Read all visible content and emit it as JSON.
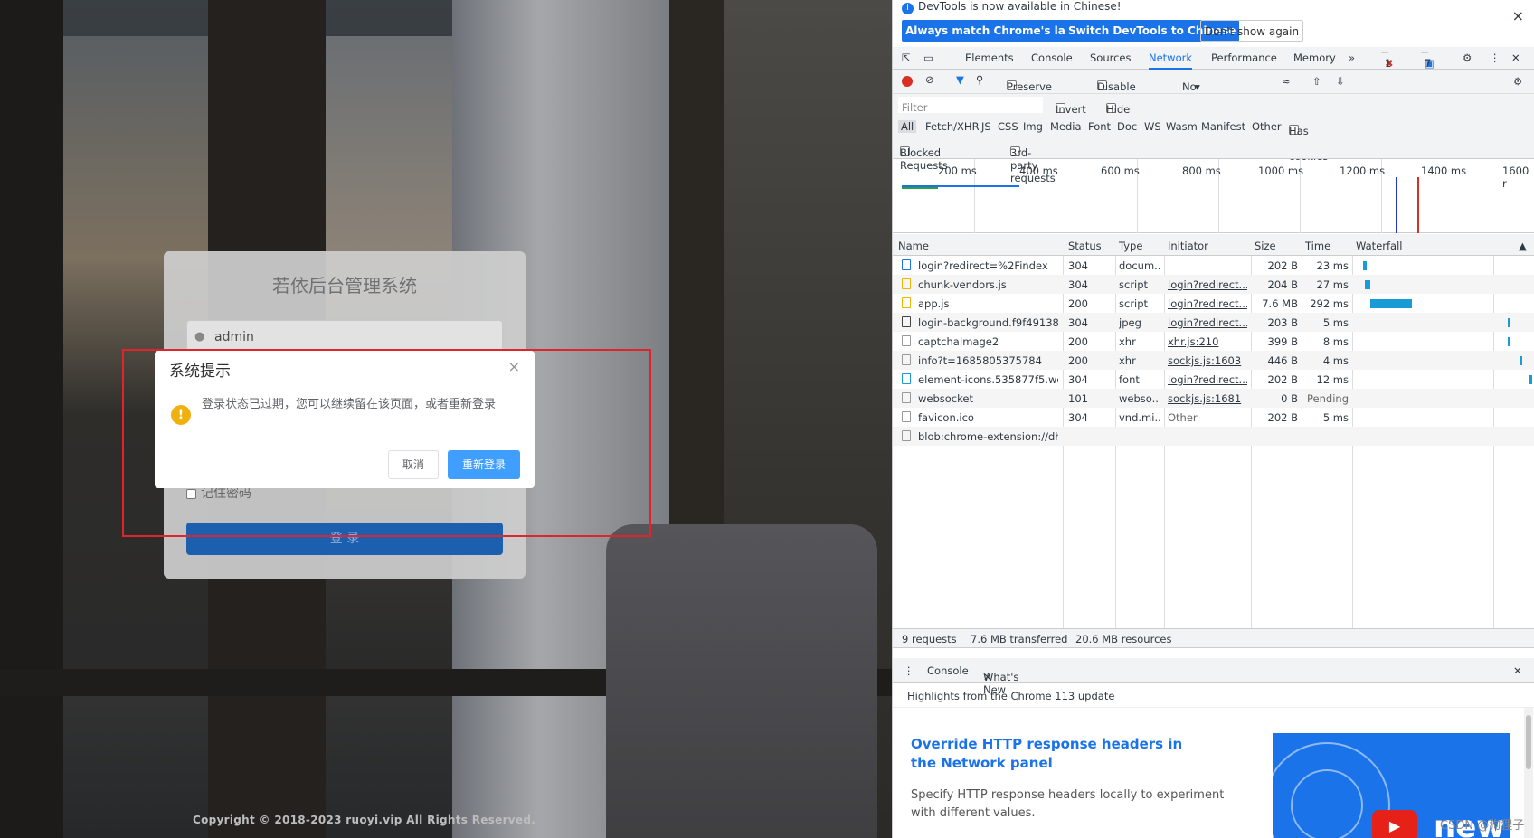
{
  "login": {
    "title": "若依后台管理系统",
    "username": "admin",
    "remember_label": "记住密码",
    "login_button": "登 录",
    "copyright": "Copyright © 2018-2023 ruoyi.vip All Rights Reserved."
  },
  "modal": {
    "title": "系统提示",
    "close": "×",
    "warn_icon": "!",
    "message": "登录状态已过期，您可以继续留在该页面，或者重新登录",
    "cancel": "取消",
    "relogin": "重新登录"
  },
  "devtools": {
    "info": {
      "message": "DevTools is now available in Chinese!",
      "btn_match": "Always match Chrome's language",
      "btn_switch": "Switch DevTools to Chinese",
      "btn_dont": "Don't show again",
      "close": "×"
    },
    "tabs": [
      "Elements",
      "Console",
      "Sources",
      "Network",
      "Performance",
      "Memory"
    ],
    "more_tabs": "»",
    "errors": "1",
    "messages": "7",
    "toolbar": {
      "preserve_log": "Preserve log",
      "disable_cache": "Disable cache",
      "throttling": "No throttling"
    },
    "filter": {
      "placeholder": "Filter",
      "invert": "Invert",
      "hide_data_urls": "Hide data URLs"
    },
    "types": [
      "All",
      "Fetch/XHR",
      "JS",
      "CSS",
      "Img",
      "Media",
      "Font",
      "Doc",
      "WS",
      "Wasm",
      "Manifest",
      "Other"
    ],
    "has_blocked_cookies": "Has blocked cookies",
    "blocked_requests": "Blocked Requests",
    "third_party": "3rd-party requests",
    "overview_ticks": [
      "200 ms",
      "400 ms",
      "600 ms",
      "800 ms",
      "1000 ms",
      "1200 ms",
      "1400 ms",
      "1600 r"
    ],
    "columns": [
      "Name",
      "Status",
      "Type",
      "Initiator",
      "Size",
      "Time",
      "Waterfall"
    ],
    "requests": [
      {
        "name": "login?redirect=%2Findex",
        "status": "304",
        "type": "docum...",
        "initiator": "",
        "size": "202 B",
        "time": "23 ms"
      },
      {
        "name": "chunk-vendors.js",
        "status": "304",
        "type": "script",
        "initiator": "login?redirect...",
        "size": "204 B",
        "time": "27 ms"
      },
      {
        "name": "app.js",
        "status": "200",
        "type": "script",
        "initiator": "login?redirect...",
        "size": "7.6 MB",
        "time": "292 ms"
      },
      {
        "name": "login-background.f9f49138....",
        "status": "304",
        "type": "jpeg",
        "initiator": "login?redirect...",
        "size": "203 B",
        "time": "5 ms"
      },
      {
        "name": "captchaImage2",
        "status": "200",
        "type": "xhr",
        "initiator": "xhr.js:210",
        "size": "399 B",
        "time": "8 ms"
      },
      {
        "name": "info?t=1685805375784",
        "status": "200",
        "type": "xhr",
        "initiator": "sockjs.js:1603",
        "size": "446 B",
        "time": "4 ms"
      },
      {
        "name": "element-icons.535877f5.woff",
        "status": "304",
        "type": "font",
        "initiator": "login?redirect...",
        "size": "202 B",
        "time": "12 ms"
      },
      {
        "name": "websocket",
        "status": "101",
        "type": "webso...",
        "initiator": "sockjs.js:1681",
        "size": "0 B",
        "time": "Pending"
      },
      {
        "name": "favicon.ico",
        "status": "304",
        "type": "vnd.mi...",
        "initiator": "Other",
        "size": "202 B",
        "time": "5 ms"
      },
      {
        "name": "blob:chrome-extension://dh...",
        "status": "",
        "type": "",
        "initiator": "",
        "size": "",
        "time": ""
      }
    ],
    "status": {
      "requests": "9 requests",
      "transferred": "7.6 MB transferred",
      "resources": "20.6 MB resources"
    },
    "drawer": {
      "console_tab": "Console",
      "whatsnew_tab": "What's New",
      "highlights": "Highlights from the Chrome 113 update",
      "headline": "Override HTTP response headers in the Network panel",
      "desc": "Specify HTTP response headers locally to experiment with different values.",
      "new_text": "new"
    }
  },
  "watermark": "CSDN @狗狸子"
}
